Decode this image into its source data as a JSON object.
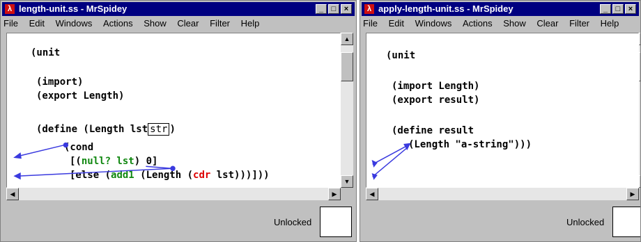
{
  "windows": [
    {
      "title": "length-unit.ss - MrSpidey",
      "menu": [
        "File",
        "Edit",
        "Windows",
        "Actions",
        "Show",
        "Clear",
        "Filter",
        "Help"
      ],
      "code": {
        "l1": "(unit",
        "l2": "(import)",
        "l3a": "(export ",
        "l3b": "Length",
        "l3c": ")",
        "l4a": "(define (",
        "l4b": "Length lst",
        "l4c": "str",
        "l4d": ")",
        "l5": "(cond",
        "l6a": "[(",
        "l6b": "null? lst",
        "l6c": ") 0]",
        "l7a": "[else (",
        "l7b": "add1",
        "l7c": " (Length (",
        "l7d": "cdr",
        "l7e": " lst)))]))"
      },
      "status": "Unlocked"
    },
    {
      "title": "apply-length-unit.ss - MrSpidey",
      "menu": [
        "File",
        "Edit",
        "Windows",
        "Actions",
        "Show",
        "Clear",
        "Filter",
        "Help"
      ],
      "code": {
        "l1": "(unit",
        "l2": "(import Length)",
        "l3a": "(export ",
        "l3b": "result",
        "l3c": ")",
        "l4a": "(define ",
        "l4b": "result",
        "l5": "(Length \"a-string\")))"
      },
      "status": "Unlocked"
    }
  ],
  "icons": {
    "app": "mrspidey-app-icon",
    "minimize": "minimize-icon",
    "maximize": "maximize-icon",
    "close": "close-icon"
  },
  "colors": {
    "titlebar": "#000080",
    "keyword_green": "#118811",
    "keyword_red": "#dd0000",
    "arrow": "#3a3adf"
  }
}
